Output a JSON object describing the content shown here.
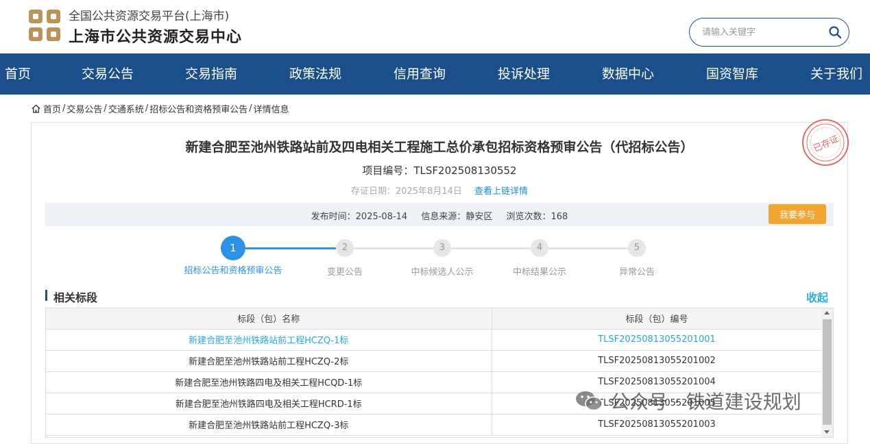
{
  "header": {
    "logo_line1": "全国公共资源交易平台(上海市)",
    "logo_line2": "上海市公共资源交易中心",
    "search_placeholder": "请输入关键字",
    "brand_color": "#1b4f8c",
    "logo_color": "#b8945a"
  },
  "nav": {
    "items": [
      "首页",
      "交易公告",
      "交易指南",
      "政策法规",
      "信用查询",
      "投诉处理",
      "数据中心",
      "国资智库",
      "关于我们"
    ]
  },
  "breadcrumb": {
    "items": [
      "首页",
      "交易公告",
      "交通系统",
      "招标公告和资格预审公告",
      "详情信息"
    ]
  },
  "notice": {
    "title": "新建合肥至池州铁路站前及四电相关工程施工总价承包招标资格预审公告（代招标公告）",
    "project_no": "项目编号：TLSF202508130552",
    "store_date": "存证日期：2025年8月14日",
    "store_link": "查看上链详情",
    "stamp_text": "已存证",
    "publish_time": "发布时间：2025-08-14",
    "source": "信息来源：静安区",
    "views": "浏览次数：168",
    "join_button": "我要参与"
  },
  "steps": [
    {
      "num": "1",
      "label": "招标公告和资格预审公告",
      "active": true
    },
    {
      "num": "2",
      "label": "变更公告",
      "active": false
    },
    {
      "num": "3",
      "label": "中标候选人公示",
      "active": false
    },
    {
      "num": "4",
      "label": "中标结果公示",
      "active": false
    },
    {
      "num": "5",
      "label": "异常公告",
      "active": false
    }
  ],
  "section": {
    "title": "相关标段",
    "collapse": "收起"
  },
  "table": {
    "headers": [
      "标段（包）名称",
      "标段（包）编号"
    ],
    "rows": [
      {
        "name": "新建合肥至池州铁路站前工程HCZQ-1标",
        "code": "TLSF20250813055201001"
      },
      {
        "name": "新建合肥至池州铁路站前工程HCZQ-2标",
        "code": "TLSF20250813055201002"
      },
      {
        "name": "新建合肥至池州铁路四电及相关工程HCQD-1标",
        "code": "TLSF20250813055201004"
      },
      {
        "name": "新建合肥至池州铁路四电及相关工程HCRD-1标",
        "code": "TLSF20250813055201005"
      },
      {
        "name": "新建合肥至池州铁路站前工程HCZQ-3标",
        "code": "TLSF20250813055201003"
      }
    ]
  },
  "watermark": {
    "text": "公众号 · 铁道建设规划"
  }
}
